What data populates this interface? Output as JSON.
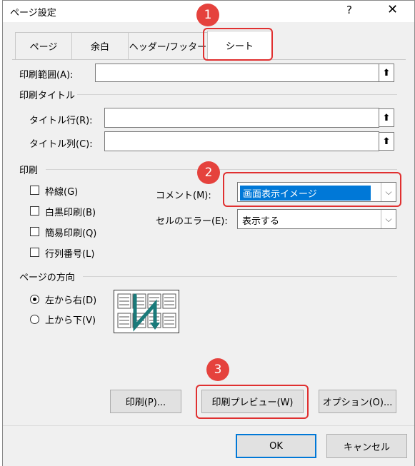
{
  "dialog": {
    "title": "ページ設定",
    "help": "?",
    "close": "✕"
  },
  "tabs": [
    {
      "label": "ページ"
    },
    {
      "label": "余白"
    },
    {
      "label": "ヘッダー/フッター"
    },
    {
      "label": "シート"
    }
  ],
  "print_area": {
    "label": "印刷範囲(A):",
    "value": ""
  },
  "print_titles": {
    "section": "印刷タイトル",
    "rows_label": "タイトル行(R):",
    "cols_label": "タイトル列(C):",
    "rows_value": "",
    "cols_value": ""
  },
  "picker_glyph": "⬆",
  "print": {
    "section": "印刷",
    "checkboxes": [
      {
        "label": "枠線(G)",
        "checked": false
      },
      {
        "label": "白黒印刷(B)",
        "checked": false
      },
      {
        "label": "簡易印刷(Q)",
        "checked": false
      },
      {
        "label": "行列番号(L)",
        "checked": false
      }
    ],
    "comments_label": "コメント(M):",
    "comments_value": "画面表示イメージ",
    "errors_label": "セルのエラー(E):",
    "errors_value": "表示する"
  },
  "page_order": {
    "section": "ページの方向",
    "options": [
      {
        "label": "左から右(D)",
        "selected": true
      },
      {
        "label": "上から下(V)",
        "selected": false
      }
    ]
  },
  "buttons": {
    "print": "印刷(P)...",
    "preview": "印刷プレビュー(W)",
    "options": "オプション(O)...",
    "ok": "OK",
    "cancel": "キャンセル"
  },
  "annotations": [
    "1",
    "2",
    "3"
  ],
  "colors": {
    "highlight": "#e03030",
    "badge": "#e5423d",
    "selection": "#0078d7"
  }
}
